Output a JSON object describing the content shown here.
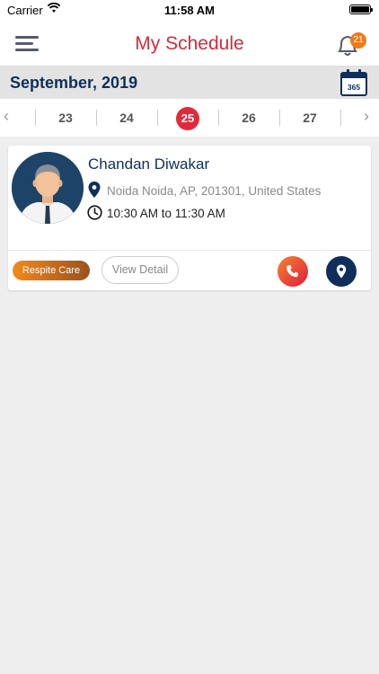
{
  "status_bar": {
    "carrier": "Carrier",
    "time": "11:58 AM"
  },
  "header": {
    "title": "My Schedule",
    "notification_count": "21"
  },
  "month_bar": {
    "label": "September, 2019",
    "calendar_icon_text": "365"
  },
  "date_strip": {
    "prev_arrow": "‹",
    "next_arrow": "›",
    "dates": [
      "23",
      "24",
      "25",
      "26",
      "27"
    ],
    "selected": "25"
  },
  "appointment": {
    "name": "Chandan Diwakar",
    "address": "Noida Noida, AP, 201301, United States",
    "time_range": "10:30 AM to 11:30 AM",
    "tag": "Respite Care",
    "view_detail_label": "View Detail"
  },
  "colors": {
    "accent_red": "#d32a3e",
    "navy": "#0f2f5a",
    "badge_orange": "#ef7a1a"
  },
  "icons": {
    "menu": "hamburger-icon",
    "notifications": "bell-icon",
    "calendar": "calendar-365-icon",
    "location": "map-pin-icon",
    "time": "clock-icon",
    "call": "phone-icon",
    "navigate": "map-pin-icon"
  }
}
